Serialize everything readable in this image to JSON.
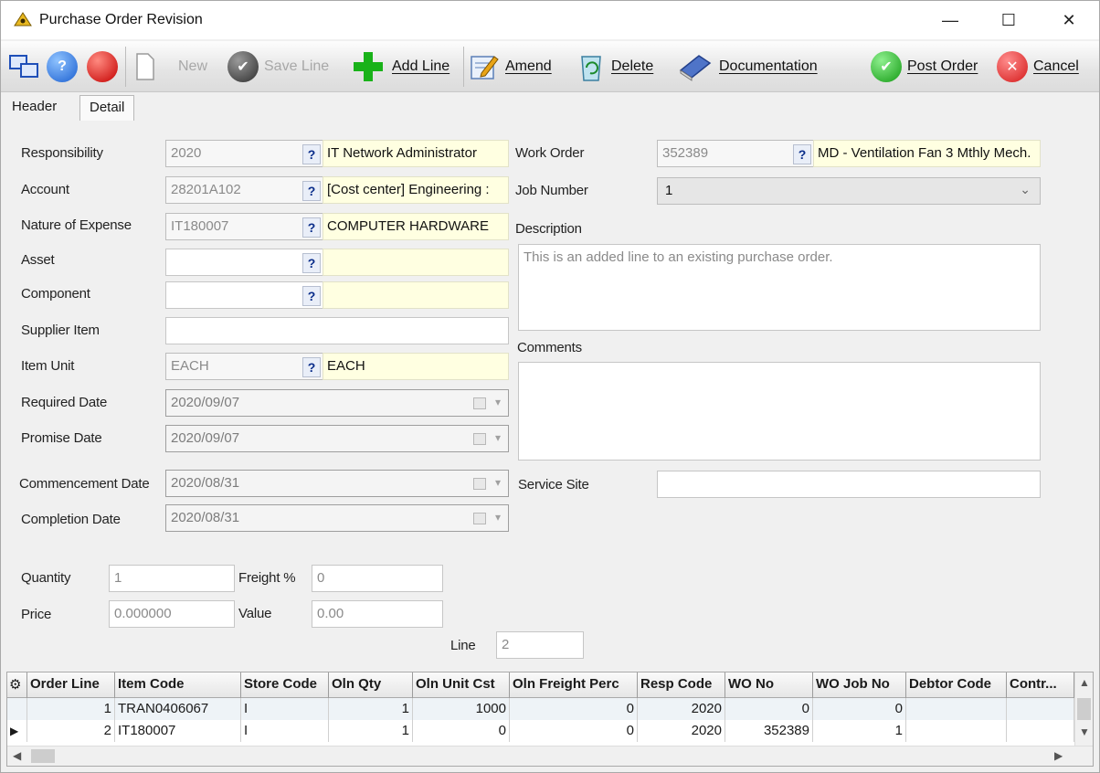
{
  "window": {
    "title": "Purchase Order Revision",
    "minimize": "—",
    "maximize": "☐",
    "close": "✕"
  },
  "toolbar": {
    "new": "New",
    "save_line": "Save Line",
    "add_line": "Add Line",
    "amend": "Amend",
    "delete": "Delete",
    "documentation": "Documentation",
    "post_order": "Post Order",
    "cancel": "Cancel"
  },
  "tabs": {
    "header": "Header",
    "detail": "Detail"
  },
  "form": {
    "responsibility": {
      "label": "Responsibility",
      "code": "2020",
      "desc": "IT Network Administrator"
    },
    "account": {
      "label": "Account",
      "code": "28201A102",
      "desc": "[Cost center]   Engineering :"
    },
    "nature_of_expense": {
      "label": "Nature of Expense",
      "code": "IT180007",
      "desc": "COMPUTER HARDWARE"
    },
    "asset": {
      "label": "Asset",
      "code": "",
      "desc": ""
    },
    "component": {
      "label": "Component",
      "code": "",
      "desc": ""
    },
    "supplier_item": {
      "label": "Supplier Item",
      "value": ""
    },
    "item_unit": {
      "label": "Item Unit",
      "code": "EACH",
      "desc": "EACH"
    },
    "required_date": {
      "label": "Required Date",
      "value": "2020/09/07"
    },
    "promise_date": {
      "label": "Promise Date",
      "value": "2020/09/07"
    },
    "commencement_date": {
      "label": "Commencement Date",
      "value": "2020/08/31"
    },
    "completion_date": {
      "label": "Completion Date",
      "value": "2020/08/31"
    },
    "quantity": {
      "label": "Quantity",
      "value": "1"
    },
    "freight": {
      "label": "Freight %",
      "value": "0"
    },
    "price": {
      "label": "Price",
      "value": "0.000000"
    },
    "value": {
      "label": "Value",
      "value": "0.00"
    },
    "line": {
      "label": "Line",
      "value": "2"
    },
    "work_order": {
      "label": "Work Order",
      "code": "352389",
      "desc": "MD - Ventilation Fan 3 Mthly Mech."
    },
    "job_number": {
      "label": "Job Number",
      "value": "1"
    },
    "description": {
      "label": "Description",
      "value": "This is an added line to an existing purchase order."
    },
    "comments": {
      "label": "Comments",
      "value": ""
    },
    "service_site": {
      "label": "Service Site",
      "value": ""
    }
  },
  "grid": {
    "columns": [
      "Order Line",
      "Item Code",
      "Store Code",
      "Oln Qty",
      "Oln Unit Cst",
      "Oln Freight Perc",
      "Resp Code",
      "WO No",
      "WO Job No",
      "Debtor Code",
      "Contr..."
    ],
    "rows": [
      {
        "order_line": "1",
        "item_code": "TRAN0406067",
        "store_code": "I",
        "qty": "1",
        "unit_cst": "1000",
        "freight": "0",
        "resp_code": "2020",
        "wo_no": "0",
        "wo_job_no": "0",
        "debtor_code": "",
        "contr": ""
      },
      {
        "order_line": "2",
        "item_code": "IT180007",
        "store_code": "I",
        "qty": "1",
        "unit_cst": "0",
        "freight": "0",
        "resp_code": "2020",
        "wo_no": "352389",
        "wo_job_no": "1",
        "debtor_code": "",
        "contr": ""
      }
    ]
  }
}
